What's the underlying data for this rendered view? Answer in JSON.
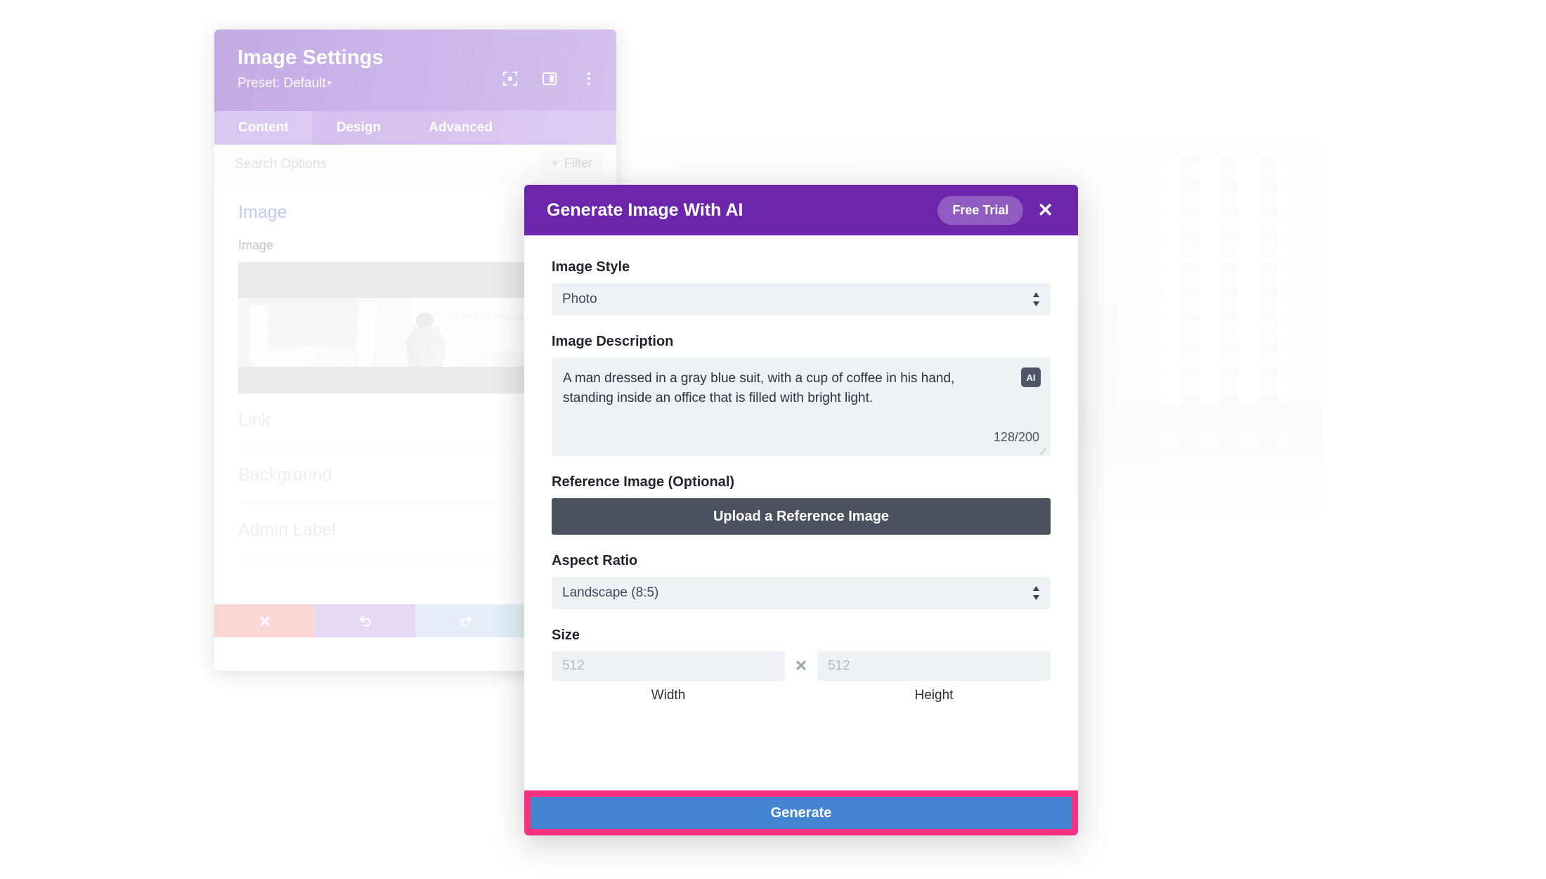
{
  "settings_panel": {
    "title": "Image Settings",
    "preset": "Preset: Default",
    "preset_caret": "▾",
    "header_icons": [
      {
        "name": "focus-target-icon"
      },
      {
        "name": "layout-panel-icon"
      },
      {
        "name": "more-options-icon"
      }
    ],
    "tabs": [
      {
        "label": "Content",
        "active": true
      },
      {
        "label": "Design",
        "active": false
      },
      {
        "label": "Advanced",
        "active": false
      }
    ],
    "search_placeholder": "Search Options",
    "filter_button": "Filter",
    "filter_icon": "+",
    "section_title": "Image",
    "image_field_label": "Image",
    "collapsed_sections": [
      "Link",
      "Background",
      "Admin Label"
    ],
    "actions": [
      {
        "name": "discard-button",
        "icon": "close-icon"
      },
      {
        "name": "undo-button",
        "icon": "undo-icon"
      },
      {
        "name": "redo-button",
        "icon": "redo-icon"
      },
      {
        "name": "save-button",
        "icon": "check-icon"
      }
    ]
  },
  "ai_modal": {
    "title": "Generate Image With AI",
    "trial_badge": "Free Trial",
    "close_label": "✕",
    "image_style": {
      "label": "Image Style",
      "value": "Photo"
    },
    "image_description": {
      "label": "Image Description",
      "value": "A man dressed in a gray blue suit, with a cup of coffee in his hand, standing inside an office that is filled with bright light.",
      "counter": "128/200",
      "ai_badge": "AI"
    },
    "reference_image": {
      "label": "Reference Image (Optional)",
      "button": "Upload a Reference Image"
    },
    "aspect_ratio": {
      "label": "Aspect Ratio",
      "value": "Landscape (8:5)"
    },
    "size": {
      "label": "Size",
      "width_placeholder": "512",
      "height_placeholder": "512",
      "separator": "✕",
      "width_caption": "Width",
      "height_caption": "Height"
    },
    "generate_button": "Generate"
  },
  "colors": {
    "modal_header": "#6c26ac",
    "panel_header": "#8e5fd0",
    "generate_blue": "#4485d1",
    "highlight_pink": "#f9327f",
    "upload_dark": "#4a5260",
    "field_bg": "#eef2f7",
    "section_blue": "#6d8fd6"
  }
}
